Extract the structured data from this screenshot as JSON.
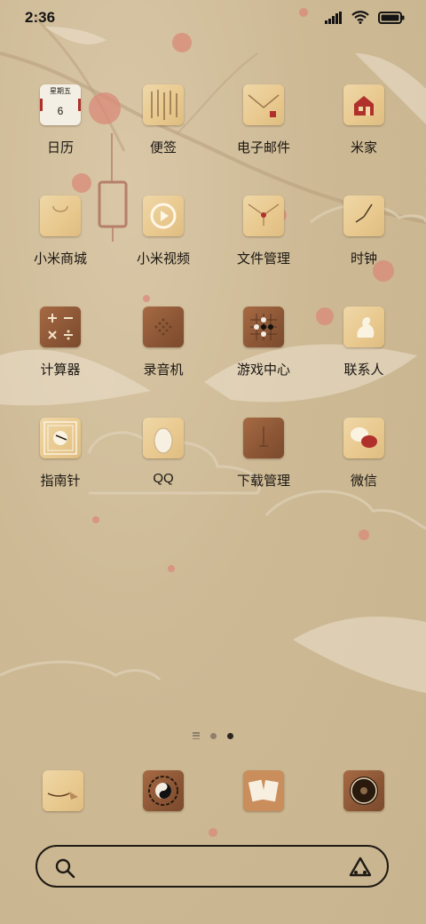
{
  "status_bar": {
    "time": "2:36",
    "icons": [
      "signal-icon",
      "wifi-icon",
      "battery-icon"
    ]
  },
  "calendar_icon": {
    "weekday": "星期五",
    "day": "6"
  },
  "apps": [
    {
      "label": "日历",
      "icon": "calendar-icon"
    },
    {
      "label": "便签",
      "icon": "notes-icon"
    },
    {
      "label": "电子邮件",
      "icon": "email-icon"
    },
    {
      "label": "米家",
      "icon": "home-icon"
    },
    {
      "label": "小米商城",
      "icon": "shopping-bag-icon"
    },
    {
      "label": "小米视频",
      "icon": "video-play-icon"
    },
    {
      "label": "文件管理",
      "icon": "file-manager-icon"
    },
    {
      "label": "时钟",
      "icon": "clock-icon"
    },
    {
      "label": "计算器",
      "icon": "calculator-icon"
    },
    {
      "label": "录音机",
      "icon": "recorder-icon"
    },
    {
      "label": "游戏中心",
      "icon": "game-board-icon"
    },
    {
      "label": "联系人",
      "icon": "contacts-icon"
    },
    {
      "label": "指南针",
      "icon": "compass-icon"
    },
    {
      "label": "QQ",
      "icon": "qq-icon"
    },
    {
      "label": "下载管理",
      "icon": "download-icon"
    },
    {
      "label": "微信",
      "icon": "wechat-icon"
    }
  ],
  "dock": [
    {
      "icon": "tassel-icon"
    },
    {
      "icon": "yin-yang-icon"
    },
    {
      "icon": "cards-icon"
    },
    {
      "icon": "camera-lens-icon"
    }
  ],
  "page_indicator": {
    "pages": 3,
    "active_index": 2
  },
  "search_bar": {
    "left_icon": "search-icon",
    "right_icon": "assistant-icon"
  }
}
